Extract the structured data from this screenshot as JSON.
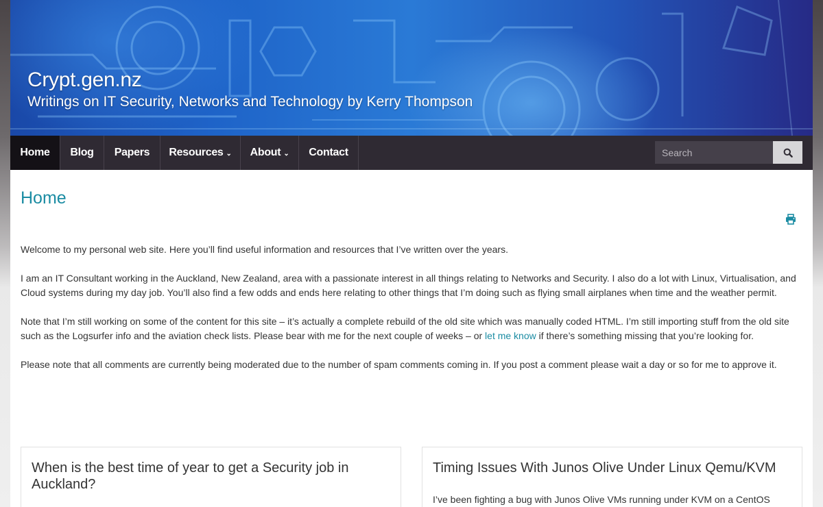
{
  "site": {
    "title": "Crypt.gen.nz",
    "tagline": "Writings on IT Security, Networks and Technology by Kerry Thompson"
  },
  "nav": {
    "items": [
      {
        "label": "Home",
        "active": true,
        "has_dropdown": false
      },
      {
        "label": "Blog",
        "active": false,
        "has_dropdown": false
      },
      {
        "label": "Papers",
        "active": false,
        "has_dropdown": false
      },
      {
        "label": "Resources",
        "active": false,
        "has_dropdown": true
      },
      {
        "label": "About",
        "active": false,
        "has_dropdown": true
      },
      {
        "label": "Contact",
        "active": false,
        "has_dropdown": false
      }
    ],
    "search_placeholder": "Search",
    "search_icon": "search-icon"
  },
  "page": {
    "title": "Home",
    "print_icon": "print-icon",
    "paragraphs": {
      "p1": "Welcome to my personal web site. Here you’ll find useful information and resources that I’ve written over the years.",
      "p2": "I am an IT Consultant working in the Auckland, New Zealand, area with a passionate interest in all things relating to Networks and Security. I also do a lot with Linux, Virtualisation, and Cloud systems during my day job. You’ll also find a few odds and ends here relating to other things that I’m doing such as flying small airplanes when time and the weather permit.",
      "p3_before": "Note that I’m still working on some of the content for this site – it’s actually a complete rebuild of the old site which was manually coded HTML. I’m still importing stuff from the old site such as the Logsurfer info and the aviation check lists. Please bear with me for the next couple of weeks – or ",
      "p3_link": "let me know",
      "p3_after": " if there’s something missing that you’re looking for.",
      "p4": "Please note that all comments are currently being moderated due to the number of spam comments coming in. If you post a comment please wait a day or so for me to approve it."
    }
  },
  "posts": [
    {
      "title": "When is the best time of year to get a Security job in Auckland?",
      "excerpt": ""
    },
    {
      "title": "Timing Issues With Junos Olive Under Linux Qemu/KVM",
      "excerpt": "I’ve been fighting a bug with Junos Olive VMs running under KVM on a CentOS"
    }
  ],
  "colors": {
    "accent": "#1b8ca3",
    "nav_bg": "#2f2a33",
    "nav_active_bg": "#141116",
    "banner_blue": "#1e63c8"
  }
}
